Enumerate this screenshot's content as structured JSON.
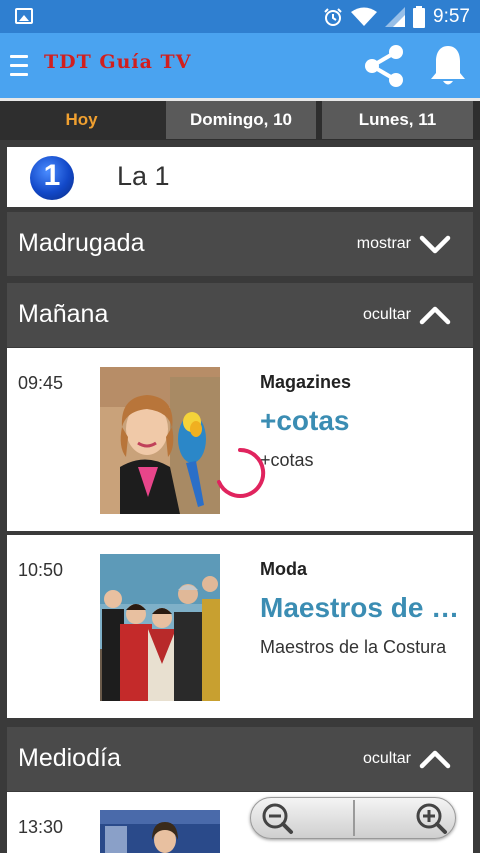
{
  "status_bar": {
    "time": "9:57",
    "icons": [
      "image-icon",
      "alarm-icon",
      "wifi-icon",
      "signal-icon",
      "battery-icon"
    ]
  },
  "app_bar": {
    "title": "TDT Guía TV",
    "title_color": "#d11f1f",
    "background": "#4aa3f0"
  },
  "tabs": [
    {
      "label": "Hoy",
      "active": true
    },
    {
      "label": "Domingo, 10",
      "active": false
    },
    {
      "label": "Lunes, 11",
      "active": false
    }
  ],
  "channel": {
    "logo_text": "1",
    "name": "La 1"
  },
  "sections": [
    {
      "label": "Madrugada",
      "action": "mostrar",
      "expanded": false
    },
    {
      "label": "Mañana",
      "action": "ocultar",
      "expanded": true
    },
    {
      "label": "Mediodía",
      "action": "ocultar",
      "expanded": true
    }
  ],
  "programs": [
    {
      "time": "09:45",
      "genre": "Magazines",
      "title": "+cotas",
      "subtitle": "+cotas"
    },
    {
      "time": "10:50",
      "genre": "Moda",
      "title": "Maestros de la Costura",
      "subtitle": "Maestros de la Costura"
    },
    {
      "time": "13:30"
    }
  ],
  "colors": {
    "accent_tab": "#f0a030",
    "program_title": "#3b8db3",
    "spinner": "#e0245e"
  }
}
